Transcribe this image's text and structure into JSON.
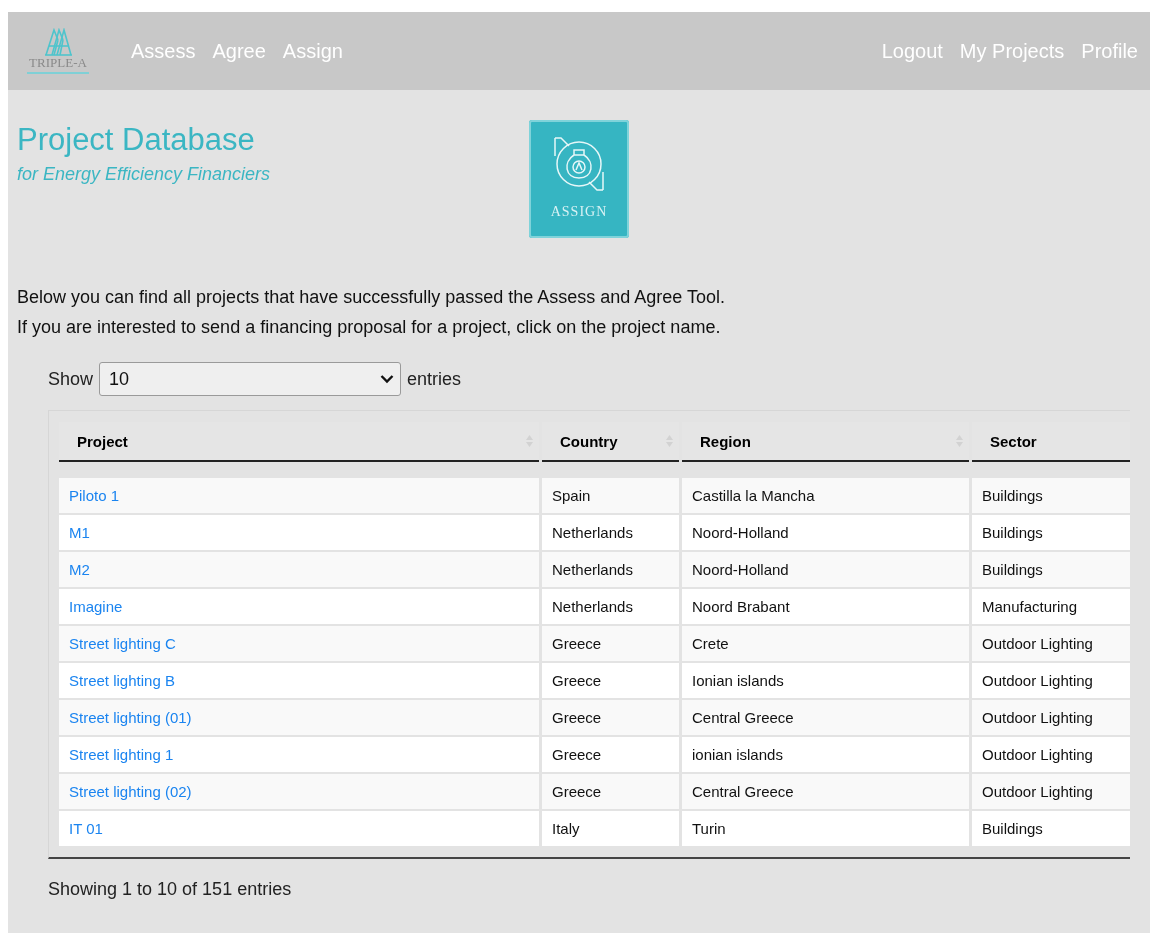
{
  "nav": {
    "brand": "TRIPLE-A",
    "left_links": [
      "Assess",
      "Agree",
      "Assign"
    ],
    "right_links": [
      "Logout",
      "My Projects",
      "Profile"
    ]
  },
  "heading": {
    "title": "Project Database",
    "subtitle": "for Energy Efficiency Financiers",
    "badge_label": "ASSIGN"
  },
  "intro": [
    "Below you can find all projects that have successfully passed the Assess and Agree Tool.",
    "If you are interested to send a financing proposal for a project, click on the project name."
  ],
  "length_menu": {
    "label_before": "Show",
    "value": "10",
    "label_after": "entries"
  },
  "table": {
    "columns": [
      {
        "label": "Project",
        "sortable": true
      },
      {
        "label": "Country",
        "sortable": true
      },
      {
        "label": "Region",
        "sortable": true
      },
      {
        "label": "Sector"
      }
    ],
    "rows": [
      {
        "project": "Piloto 1",
        "country": "Spain",
        "region": "Castilla la Mancha",
        "sector": "Buildings"
      },
      {
        "project": "M1",
        "country": "Netherlands",
        "region": "Noord-Holland",
        "sector": "Buildings"
      },
      {
        "project": "M2",
        "country": "Netherlands",
        "region": "Noord-Holland",
        "sector": "Buildings"
      },
      {
        "project": "Imagine",
        "country": "Netherlands",
        "region": "Noord Brabant",
        "sector": "Manufacturing"
      },
      {
        "project": "Street lighting C",
        "country": "Greece",
        "region": "Crete",
        "sector": "Outdoor Lighting"
      },
      {
        "project": "Street lighting B",
        "country": "Greece",
        "region": "Ionian islands",
        "sector": "Outdoor Lighting"
      },
      {
        "project": "Street lighting (01)",
        "country": "Greece",
        "region": "Central Greece",
        "sector": "Outdoor Lighting"
      },
      {
        "project": "Street lighting 1",
        "country": "Greece",
        "region": "ionian islands",
        "sector": "Outdoor Lighting"
      },
      {
        "project": "Street lighting (02)",
        "country": "Greece",
        "region": "Central Greece",
        "sector": "Outdoor Lighting"
      },
      {
        "project": "IT 01",
        "country": "Italy",
        "region": "Turin",
        "sector": "Buildings"
      }
    ]
  },
  "info": "Showing 1 to 10 of 151 entries"
}
